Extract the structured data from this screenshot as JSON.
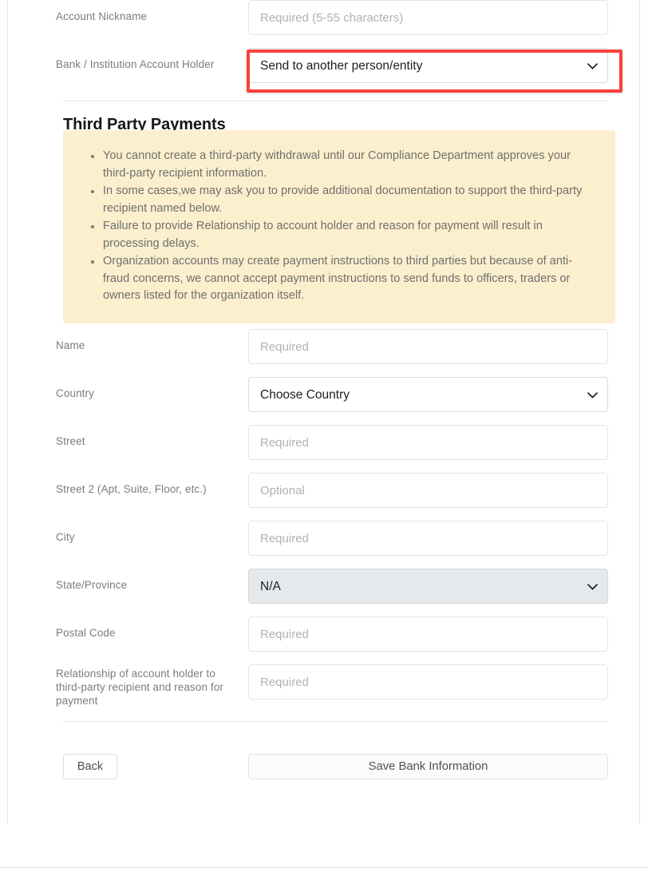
{
  "top_fields": [
    {
      "id": "account-nickname",
      "label": "Account Nickname",
      "type": "text",
      "placeholder": "Required (5-55 characters)",
      "value": ""
    },
    {
      "id": "bank-institution-account-holder",
      "label": "Bank / Institution Account Holder",
      "type": "select",
      "value": "Send to another person/entity",
      "highlighted": true
    }
  ],
  "section": {
    "title": "Third Party Payments"
  },
  "warning": {
    "background_color": "#FCEFCD",
    "items": [
      "You cannot create a third-party withdrawal until our Compliance Department approves your third-party recipient information.",
      "In some cases,we may ask you to provide additional documentation to support the third-party recipient named below.",
      "Failure to provide Relationship to account holder and reason for payment will result in processing delays.",
      "Organization accounts may create payment instructions to third parties but because of anti-fraud concerns, we cannot accept payment instructions to send funds to officers, traders or owners listed for the organization itself."
    ]
  },
  "recipient_fields": [
    {
      "id": "name",
      "label": "Name",
      "type": "text",
      "placeholder": "Required",
      "value": ""
    },
    {
      "id": "country",
      "label": "Country",
      "type": "select",
      "value": "Choose Country",
      "disabled": false
    },
    {
      "id": "street",
      "label": "Street",
      "type": "text",
      "placeholder": "Required",
      "value": ""
    },
    {
      "id": "street-2",
      "label": "Street 2 (Apt, Suite, Floor, etc.)",
      "type": "text",
      "placeholder": "Optional",
      "value": ""
    },
    {
      "id": "city",
      "label": "City",
      "type": "text",
      "placeholder": "Required",
      "value": ""
    },
    {
      "id": "state-province",
      "label": "State/Province",
      "type": "select",
      "value": "N/A",
      "disabled": true
    },
    {
      "id": "postal-code",
      "label": "Postal Code",
      "type": "text",
      "placeholder": "Required",
      "value": ""
    },
    {
      "id": "relationship-reason",
      "label": "Relationship of account holder to third-party recipient and reason for payment",
      "type": "text",
      "placeholder": "Required",
      "value": ""
    }
  ],
  "actions": {
    "back_label": "Back",
    "save_label": "Save Bank Information"
  },
  "annotation": {
    "highlight_color": "#F9423A",
    "target": "bank-institution-account-holder"
  }
}
